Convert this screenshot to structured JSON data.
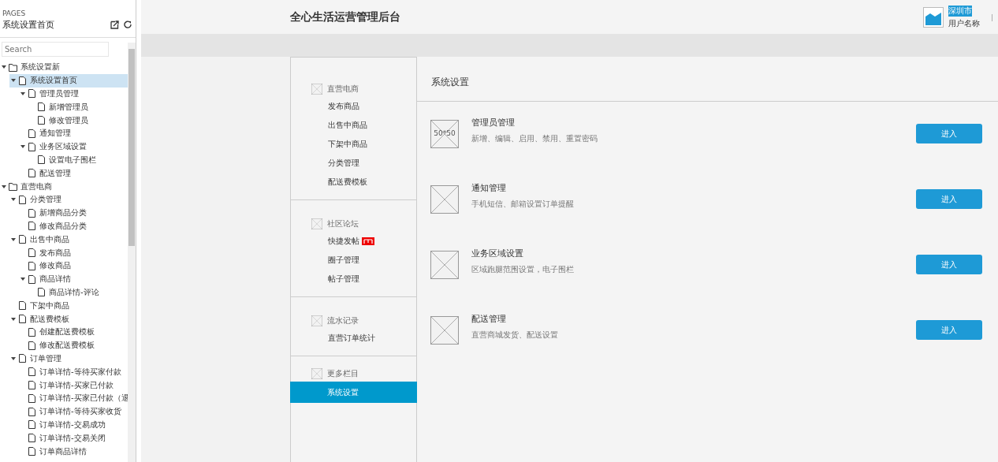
{
  "pages_panel": {
    "heading": "PAGES",
    "current_page": "系统设置首页",
    "search": {
      "placeholder": "Search"
    },
    "tree": [
      {
        "label": "系统设置新",
        "kind": "folder",
        "expanded": true,
        "selected": false,
        "children": [
          {
            "label": "系统设置首页",
            "kind": "page",
            "expanded": true,
            "selected": true,
            "children": [
              {
                "label": "管理员管理",
                "kind": "page",
                "expanded": true,
                "selected": false,
                "children": [
                  {
                    "label": "新增管理员",
                    "kind": "page",
                    "selected": false
                  },
                  {
                    "label": "修改管理员",
                    "kind": "page",
                    "selected": false
                  }
                ]
              },
              {
                "label": "通知管理",
                "kind": "page",
                "selected": false
              },
              {
                "label": "业务区域设置",
                "kind": "page",
                "expanded": true,
                "selected": false,
                "children": [
                  {
                    "label": "设置电子围栏",
                    "kind": "page",
                    "selected": false
                  }
                ]
              },
              {
                "label": "配送管理",
                "kind": "page",
                "selected": false
              }
            ]
          }
        ]
      },
      {
        "label": "直营电商",
        "kind": "folder",
        "expanded": true,
        "selected": false,
        "children": [
          {
            "label": "分类管理",
            "kind": "page",
            "expanded": true,
            "selected": false,
            "children": [
              {
                "label": "新增商品分类",
                "kind": "page",
                "selected": false
              },
              {
                "label": "修改商品分类",
                "kind": "page",
                "selected": false
              }
            ]
          },
          {
            "label": "出售中商品",
            "kind": "page",
            "expanded": true,
            "selected": false,
            "children": [
              {
                "label": "发布商品",
                "kind": "page",
                "selected": false
              },
              {
                "label": "修改商品",
                "kind": "page",
                "selected": false
              },
              {
                "label": "商品详情",
                "kind": "page",
                "expanded": true,
                "selected": false,
                "children": [
                  {
                    "label": "商品详情-评论",
                    "kind": "page",
                    "selected": false
                  }
                ]
              }
            ]
          },
          {
            "label": "下架中商品",
            "kind": "page",
            "selected": false
          },
          {
            "label": "配送费模板",
            "kind": "page",
            "expanded": true,
            "selected": false,
            "children": [
              {
                "label": "创建配送费模板",
                "kind": "page",
                "selected": false
              },
              {
                "label": "修改配送费模板",
                "kind": "page",
                "selected": false
              }
            ]
          },
          {
            "label": "订单管理",
            "kind": "page",
            "expanded": true,
            "selected": false,
            "children": [
              {
                "label": "订单详情-等待买家付款",
                "kind": "page",
                "selected": false
              },
              {
                "label": "订单详情-买家已付款",
                "kind": "page",
                "selected": false
              },
              {
                "label": "订单详情-买家已付款（退",
                "kind": "page",
                "selected": false
              },
              {
                "label": "订单详情-等待买家收货",
                "kind": "page",
                "selected": false
              },
              {
                "label": "订单详情-交易成功",
                "kind": "page",
                "selected": false
              },
              {
                "label": "订单详情-交易关闭",
                "kind": "page",
                "selected": false
              },
              {
                "label": "订单商品详情",
                "kind": "page",
                "selected": false
              }
            ]
          }
        ]
      }
    ]
  },
  "header": {
    "title": "全心生活运营管理后台",
    "city": "深圳市",
    "user": "用户名称",
    "separator": "|"
  },
  "nav": [
    {
      "title": "直营电商",
      "items": [
        {
          "label": "发布商品",
          "selected": false
        },
        {
          "label": "出售中商品",
          "selected": false
        },
        {
          "label": "下架中商品",
          "selected": false
        },
        {
          "label": "分类管理",
          "selected": false
        },
        {
          "label": "配送费模板",
          "selected": false
        }
      ]
    },
    {
      "title": "社区论坛",
      "items": [
        {
          "label": "快捷发帖",
          "selected": false,
          "tag": true
        },
        {
          "label": "圈子管理",
          "selected": false
        },
        {
          "label": "帖子管理",
          "selected": false
        }
      ]
    },
    {
      "title": "流水记录",
      "items": [
        {
          "label": "直营订单统计",
          "selected": false
        }
      ]
    },
    {
      "title": "更多栏目",
      "items": [
        {
          "label": "系统设置",
          "selected": true
        }
      ]
    }
  ],
  "content": {
    "title": "系统设置",
    "rows": [
      {
        "thumb_label": "50*50",
        "name": "管理员管理",
        "description": "新增、编辑、启用、禁用、重置密码",
        "button": "进入"
      },
      {
        "name": "通知管理",
        "description": "手机短信、邮箱设置订单提醒",
        "button": "进入"
      },
      {
        "name": "业务区域设置",
        "description": "区域跑腿范围设置，电子围栏",
        "button": "进入"
      },
      {
        "name": "配送管理",
        "description": "直营商城发货、配送设置",
        "button": "进入"
      }
    ]
  }
}
